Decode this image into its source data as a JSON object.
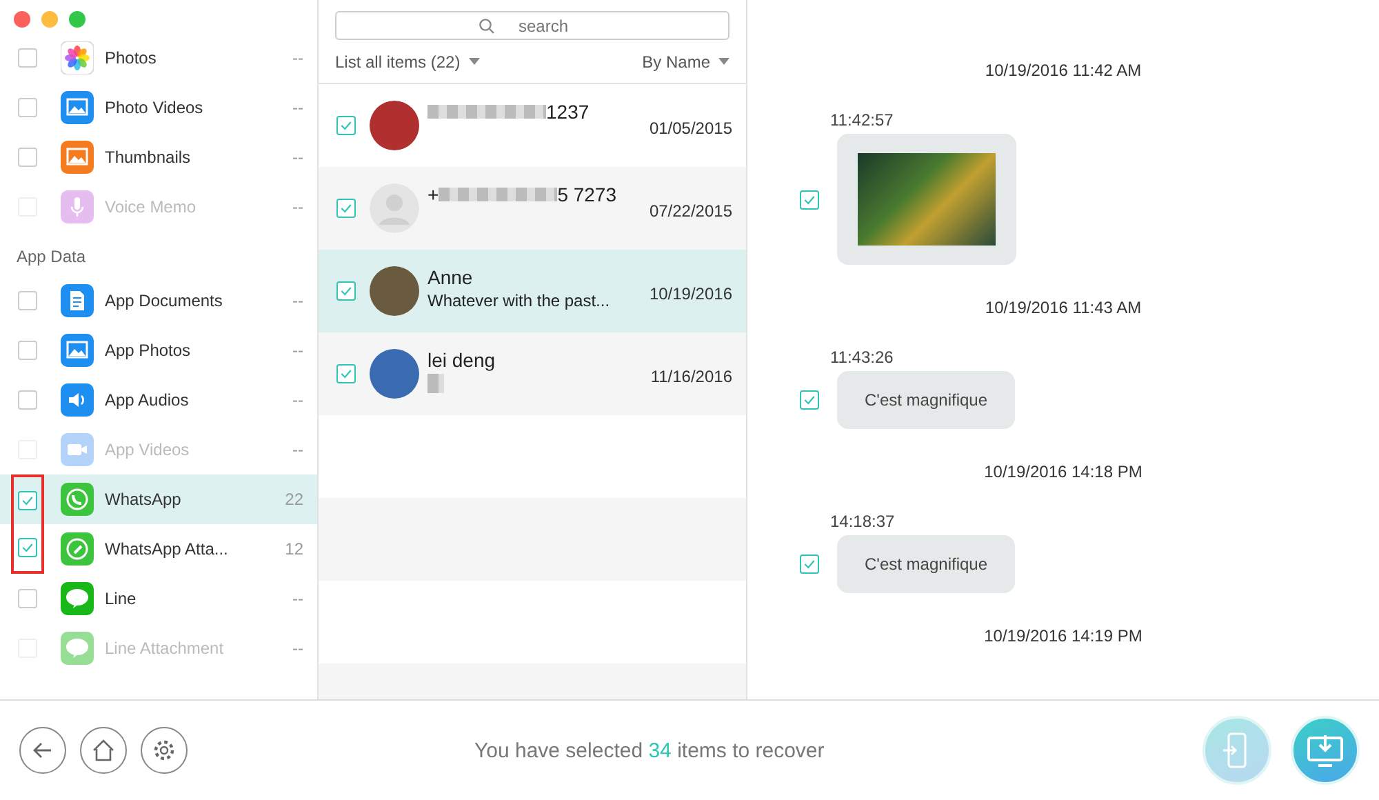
{
  "sidebar": {
    "groups": [
      {
        "items": [
          {
            "label": "Photos",
            "count": "--",
            "checked": false,
            "disabled": false,
            "selected": false,
            "highlighted": false
          },
          {
            "label": "Photo Videos",
            "count": "--",
            "checked": false,
            "disabled": false,
            "selected": false,
            "highlighted": false
          },
          {
            "label": "Thumbnails",
            "count": "--",
            "checked": false,
            "disabled": false,
            "selected": false,
            "highlighted": false
          },
          {
            "label": "Voice Memo",
            "count": "--",
            "checked": false,
            "disabled": true,
            "selected": false,
            "highlighted": false
          }
        ]
      },
      {
        "title": "App Data",
        "items": [
          {
            "label": "App Documents",
            "count": "--",
            "checked": false,
            "disabled": false,
            "selected": false,
            "highlighted": false
          },
          {
            "label": "App Photos",
            "count": "--",
            "checked": false,
            "disabled": false,
            "selected": false,
            "highlighted": false
          },
          {
            "label": "App Audios",
            "count": "--",
            "checked": false,
            "disabled": false,
            "selected": false,
            "highlighted": false
          },
          {
            "label": "App Videos",
            "count": "--",
            "checked": false,
            "disabled": true,
            "selected": false,
            "highlighted": false
          },
          {
            "label": "WhatsApp",
            "count": "22",
            "checked": true,
            "disabled": false,
            "selected": true,
            "highlighted": true
          },
          {
            "label": "WhatsApp Atta...",
            "count": "12",
            "checked": true,
            "disabled": false,
            "selected": false,
            "highlighted": true
          },
          {
            "label": "Line",
            "count": "--",
            "checked": false,
            "disabled": false,
            "selected": false,
            "highlighted": false
          },
          {
            "label": "Line Attachment",
            "count": "--",
            "checked": false,
            "disabled": true,
            "selected": false,
            "highlighted": false
          }
        ]
      }
    ]
  },
  "search": {
    "placeholder": "search"
  },
  "list_filter": "List all items (22)",
  "sort": "By Name",
  "contacts": [
    {
      "kind": "photo",
      "name": "1237",
      "blurred": true,
      "preview_blurred": false,
      "date": "01/05/2015",
      "checked": true,
      "selected": false
    },
    {
      "kind": "default",
      "lead": "+",
      "name": "5 7273",
      "blurred": true,
      "preview_blurred": false,
      "date": "07/22/2015",
      "checked": true,
      "selected": false
    },
    {
      "kind": "photo",
      "name": "Anne",
      "blurred": false,
      "preview": "Whatever with the past...",
      "preview_blurred": false,
      "date": "10/19/2016",
      "checked": true,
      "selected": true
    },
    {
      "kind": "photo",
      "name": "lei deng",
      "blurred": false,
      "preview_blurred": true,
      "date": "11/16/2016",
      "checked": true,
      "selected": false
    }
  ],
  "messages": [
    {
      "kind": "date",
      "text": "10/19/2016 11:42 AM"
    },
    {
      "kind": "image",
      "time": "11:42:57",
      "checked": true
    },
    {
      "kind": "date",
      "text": "10/19/2016 11:43 AM"
    },
    {
      "kind": "text",
      "time": "11:43:26",
      "text": "C'est magnifique",
      "checked": true
    },
    {
      "kind": "date",
      "text": "10/19/2016 14:18 PM"
    },
    {
      "kind": "text",
      "time": "14:18:37",
      "text": "C'est magnifique",
      "checked": true
    },
    {
      "kind": "date",
      "text": "10/19/2016 14:19 PM"
    }
  ],
  "status": {
    "before": "You have selected",
    "count": "34",
    "after": "items to recover"
  }
}
